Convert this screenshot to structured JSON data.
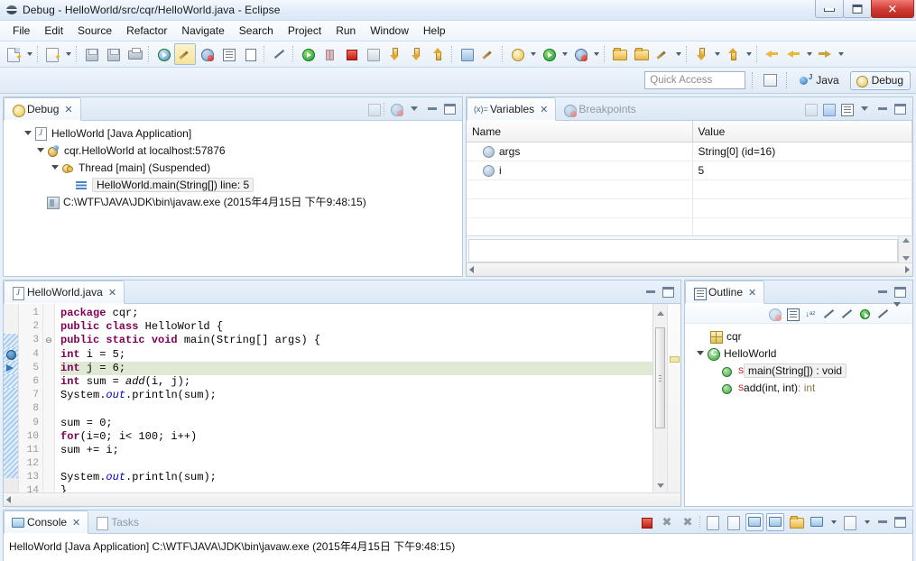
{
  "window": {
    "title": "Debug - HelloWorld/src/cqr/HelloWorld.java - Eclipse",
    "minimize_label": "Minimize",
    "maximize_label": "Maximize",
    "close_label": "✕"
  },
  "menubar": {
    "items": [
      "File",
      "Edit",
      "Source",
      "Refactor",
      "Navigate",
      "Search",
      "Project",
      "Run",
      "Window",
      "Help"
    ]
  },
  "quick_access": {
    "placeholder": "Quick Access",
    "value": ""
  },
  "perspectives": [
    {
      "label": "Java",
      "active": false
    },
    {
      "label": "Debug",
      "active": true
    }
  ],
  "debug_view": {
    "tab_label": "Debug",
    "tab_close": "✕",
    "tree": [
      {
        "label": "HelloWorld [Java Application]",
        "indent": 1,
        "icon": "java-application-icon",
        "expanded": true,
        "selected": false
      },
      {
        "label": "cqr.HelloWorld at localhost:57876",
        "indent": 2,
        "icon": "debug-target-icon",
        "expanded": true,
        "selected": false
      },
      {
        "label": "Thread [main] (Suspended)",
        "indent": 3,
        "icon": "thread-icon",
        "expanded": true,
        "selected": false
      },
      {
        "label": "HelloWorld.main(String[]) line: 5",
        "indent": 4,
        "icon": "stack-frame-icon",
        "expanded": false,
        "selected": true
      },
      {
        "label": "C:\\WTF\\JAVA\\JDK\\bin\\javaw.exe (2015年4月15日 下午9:48:15)",
        "indent": 2,
        "icon": "process-icon",
        "expanded": false,
        "selected": false
      }
    ]
  },
  "variables_view": {
    "tabs": [
      {
        "label": "Variables",
        "active": true,
        "close": "✕",
        "icon": "variables-icon"
      },
      {
        "label": "Breakpoints",
        "active": false,
        "close": "",
        "icon": "breakpoints-icon"
      }
    ],
    "columns": [
      "Name",
      "Value"
    ],
    "rows": [
      {
        "name": "args",
        "value": "String[0]  (id=16)"
      },
      {
        "name": "i",
        "value": "5"
      }
    ],
    "detail_text": ""
  },
  "editor": {
    "tab_label": "HelloWorld.java",
    "tab_close": "✕",
    "tab_icon": "java-file-icon",
    "current_line": 5,
    "lines": [
      {
        "no": 1,
        "fold": "",
        "text": "package cqr;",
        "marker": ""
      },
      {
        "no": 2,
        "fold": "",
        "text": "public class HelloWorld {",
        "marker": ""
      },
      {
        "no": 3,
        "fold": "⊖",
        "text": "public static void main(String[] args) {",
        "marker": ""
      },
      {
        "no": 4,
        "fold": "",
        "text": "int i = 5;",
        "marker": "breakpoint"
      },
      {
        "no": 5,
        "fold": "",
        "text": "int j = 6;",
        "marker": "current-instruction"
      },
      {
        "no": 6,
        "fold": "",
        "text": "int sum = add(i, j);",
        "marker": ""
      },
      {
        "no": 7,
        "fold": "",
        "text": "System.out.println(sum);",
        "marker": ""
      },
      {
        "no": 8,
        "fold": "",
        "text": "",
        "marker": ""
      },
      {
        "no": 9,
        "fold": "",
        "text": "sum = 0;",
        "marker": ""
      },
      {
        "no": 10,
        "fold": "",
        "text": "for(i=0; i< 100; i++)",
        "marker": ""
      },
      {
        "no": 11,
        "fold": "",
        "text": "sum += i;",
        "marker": ""
      },
      {
        "no": 12,
        "fold": "",
        "text": "",
        "marker": ""
      },
      {
        "no": 13,
        "fold": "",
        "text": "System.out.println(sum);",
        "marker": ""
      },
      {
        "no": 14,
        "fold": "",
        "text": "}",
        "marker": ""
      }
    ]
  },
  "outline_view": {
    "tab_label": "Outline",
    "tab_close": "✕",
    "items": [
      {
        "label": "cqr",
        "suffix": "",
        "indent": 1,
        "icon": "package-icon",
        "expanded": false,
        "static": false,
        "selected": false
      },
      {
        "label": "HelloWorld",
        "suffix": "",
        "indent": 1,
        "icon": "class-icon",
        "expanded": true,
        "static": false,
        "selected": false
      },
      {
        "label": "main(String[]) : void",
        "suffix": "",
        "indent": 2,
        "icon": "method-icon",
        "expanded": false,
        "static": true,
        "selected": true
      },
      {
        "label": "add(int, int)",
        "suffix": " : int",
        "indent": 2,
        "icon": "method-icon",
        "expanded": false,
        "static": true,
        "selected": false
      }
    ]
  },
  "console_view": {
    "tabs": [
      {
        "label": "Console",
        "active": true,
        "close": "✕",
        "icon": "console-icon"
      },
      {
        "label": "Tasks",
        "active": false,
        "close": "",
        "icon": "tasks-icon"
      }
    ],
    "output": "HelloWorld [Java Application] C:\\WTF\\JAVA\\JDK\\bin\\javaw.exe (2015年4月15日 下午9:48:15)"
  },
  "colors": {
    "keyword": "#7f0055",
    "field": "#0000c0",
    "current_line_highlight": "#dfe9d4",
    "accent_border": "#b5c8dc",
    "chrome_background": "#e8f0f9"
  }
}
